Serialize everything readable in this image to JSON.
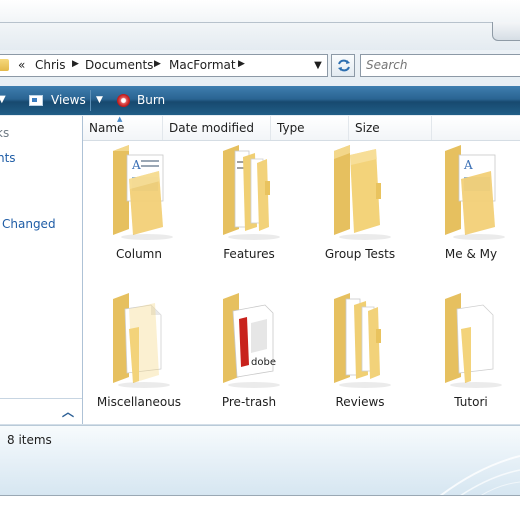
{
  "address_bar": {
    "overflow": "«",
    "segments": [
      "Chris",
      "Documents",
      "MacFormat"
    ],
    "separator": "▶",
    "dropdown": "▼"
  },
  "search": {
    "placeholder": "Search"
  },
  "command_bar": {
    "organize_dropdown": "▼",
    "views_label": "Views",
    "views_dropdown": "▼",
    "burn_label": "Burn"
  },
  "nav_pane": {
    "items": [
      "ks",
      "nts",
      "Changed"
    ],
    "collapse_glyph": "︿"
  },
  "columns": [
    "Name",
    "Date modified",
    "Type",
    "Size"
  ],
  "sort_indicator": "▲",
  "files": [
    {
      "name": "Column",
      "icon": "folder-document-icon"
    },
    {
      "name": "Features",
      "icon": "folder-pages-icon"
    },
    {
      "name": "Group Tests",
      "icon": "folder-empty-icon"
    },
    {
      "name": "Me & My",
      "icon": "folder-document-icon"
    },
    {
      "name": "Miscellaneous",
      "icon": "folder-blank-page-icon"
    },
    {
      "name": "Pre-trash",
      "icon": "folder-adobe-doc-icon"
    },
    {
      "name": "Reviews",
      "icon": "folder-pages-icon"
    },
    {
      "name": "Tutori",
      "icon": "folder-blank-page-icon"
    }
  ],
  "status_bar": {
    "text": "8 items"
  },
  "colors": {
    "command_bar": "#2a6492",
    "folder_yellow": "#f3d37a",
    "nav_link": "#1f5da6"
  }
}
